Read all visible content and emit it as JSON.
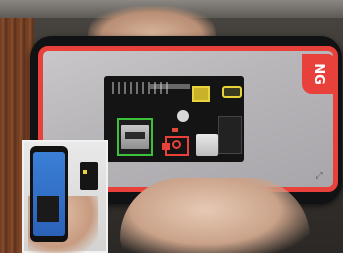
{
  "inspection_result": {
    "status_label": "NG",
    "status_color": "#e8403a"
  },
  "highlight_colors": {
    "pass_outline": "#3cc23a",
    "warning_outline": "#e8d33a",
    "defect_outline": "#e8403a"
  },
  "corner_icon": "expand-icon",
  "corner_glyph": "⤢"
}
